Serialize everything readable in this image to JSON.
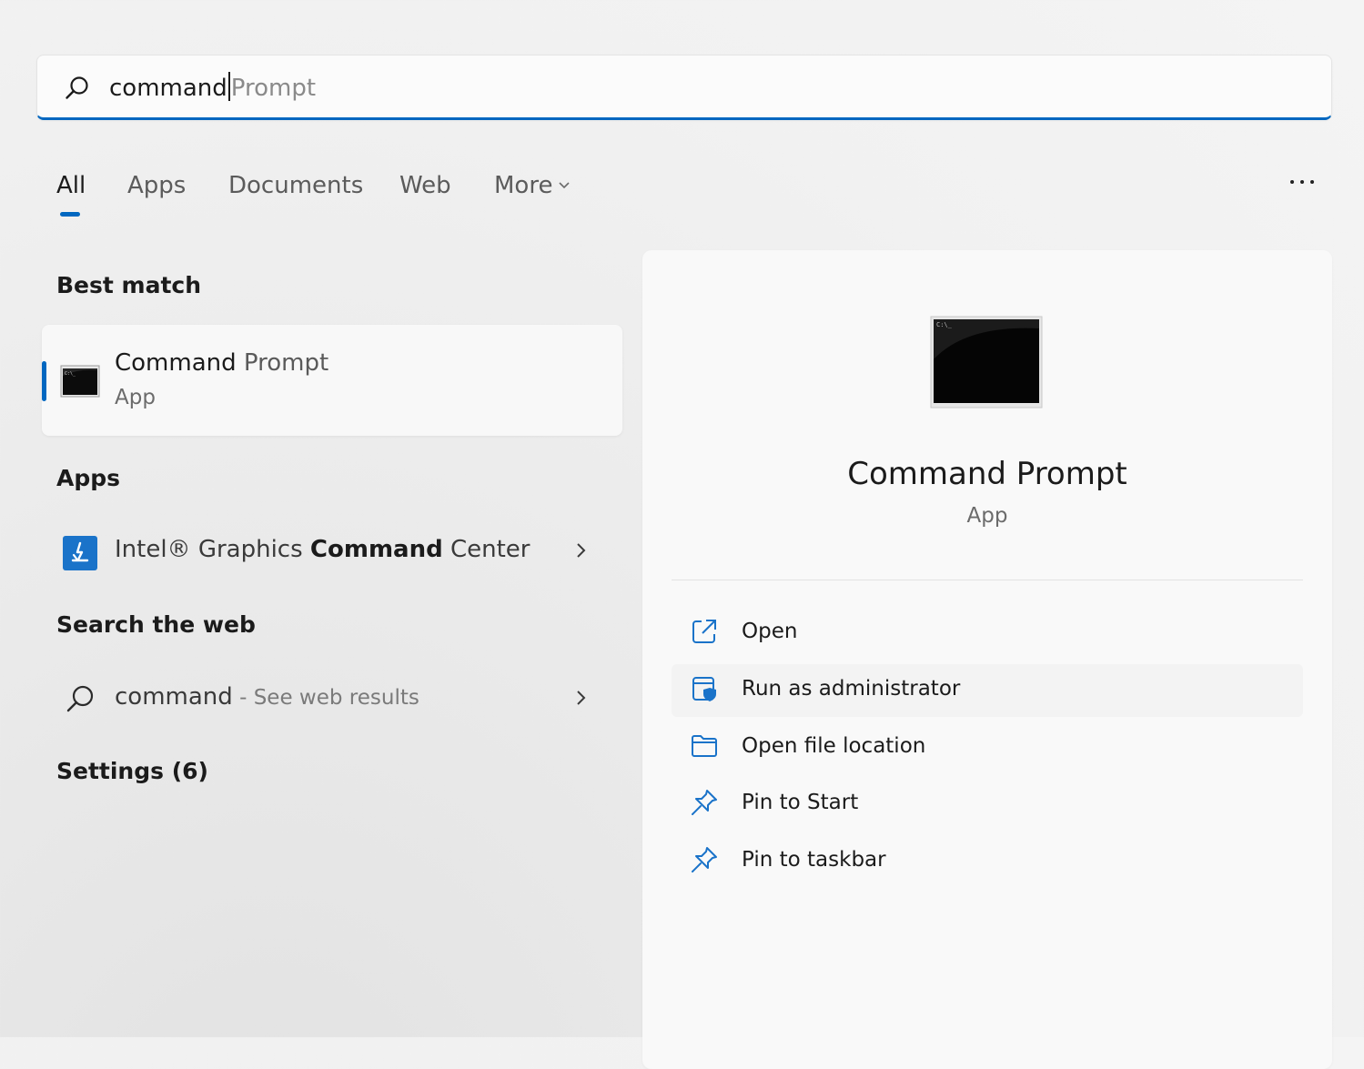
{
  "search": {
    "typed": "command",
    "suggestion": "Prompt"
  },
  "tabs": [
    {
      "label": "All"
    },
    {
      "label": "Apps"
    },
    {
      "label": "Documents"
    },
    {
      "label": "Web"
    },
    {
      "label": "More"
    }
  ],
  "sections": {
    "best_match": "Best match",
    "apps": "Apps",
    "search_web": "Search the web",
    "settings": "Settings (6)"
  },
  "best_match": {
    "title_bold": "Command",
    "title_rest": " Prompt",
    "subtitle": "App"
  },
  "apps_result": {
    "prefix": "Intel® Graphics ",
    "bold": "Command",
    "suffix": " Center"
  },
  "web_result": {
    "query": "command",
    "suffix": " - See web results"
  },
  "detail": {
    "title": "Command Prompt",
    "subtitle": "App",
    "actions": [
      {
        "label": "Open",
        "icon": "open-external-icon"
      },
      {
        "label": "Run as administrator",
        "icon": "shield-admin-icon"
      },
      {
        "label": "Open file location",
        "icon": "folder-icon"
      },
      {
        "label": "Pin to Start",
        "icon": "pin-icon"
      },
      {
        "label": "Pin to taskbar",
        "icon": "pin-icon"
      }
    ]
  },
  "colors": {
    "accent": "#0067c0",
    "icon_blue": "#1a73c9"
  }
}
